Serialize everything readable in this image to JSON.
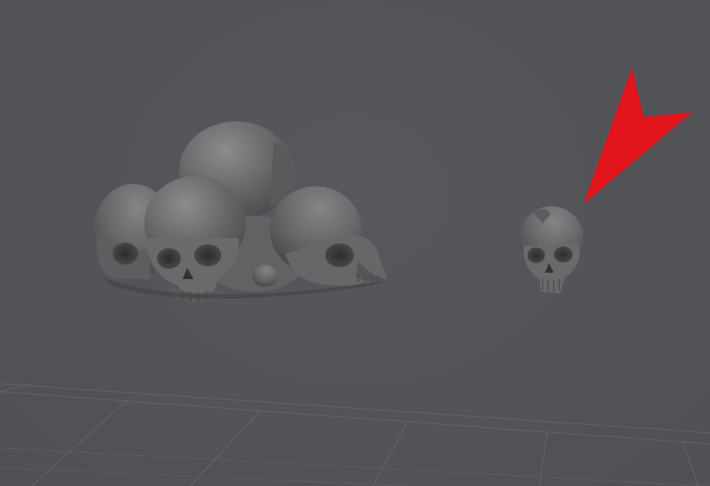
{
  "viewport": {
    "background_color": "#535458",
    "grid_color": "#6a6b70",
    "mesh_color": "#6c6c6e",
    "annotation_color": "#e0141a"
  },
  "scene": {
    "objects": [
      {
        "name": "skull-pile-model",
        "kind": "mesh"
      },
      {
        "name": "single-skull-model",
        "kind": "mesh"
      }
    ],
    "annotation": {
      "type": "arrow",
      "points_to": "single-skull-model"
    }
  }
}
